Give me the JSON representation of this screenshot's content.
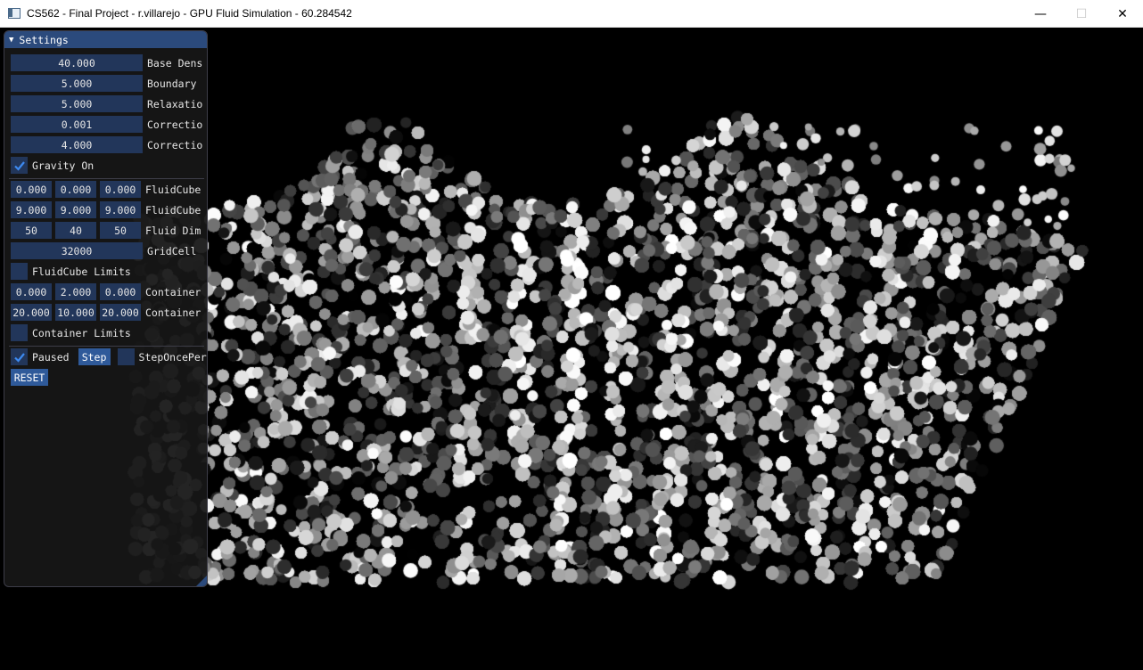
{
  "window": {
    "title": "CS562 - Final Project - r.villarejo - GPU Fluid Simulation - 60.284542",
    "minimize_glyph": "—",
    "maximize_glyph": "☐",
    "close_glyph": "✕"
  },
  "panel": {
    "header": "Settings",
    "collapse_glyph": "▼",
    "base_density": {
      "value": "40.000",
      "label": "Base Dens"
    },
    "boundary": {
      "value": "5.000",
      "label": "Boundary"
    },
    "relaxation": {
      "value": "5.000",
      "label": "Relaxatio"
    },
    "correction_1": {
      "value": "0.001",
      "label": "Correctio"
    },
    "correction_2": {
      "value": "4.000",
      "label": "Correctio"
    },
    "gravity": {
      "label": "Gravity On",
      "checked": true
    },
    "fluidcube_min": {
      "values": [
        "0.000",
        "0.000",
        "0.000"
      ],
      "label": "FluidCube"
    },
    "fluidcube_max": {
      "values": [
        "9.000",
        "9.000",
        "9.000"
      ],
      "label": "FluidCube"
    },
    "fluid_dim": {
      "values": [
        "50",
        "40",
        "50"
      ],
      "label": "Fluid Dim"
    },
    "grid_cell": {
      "value": "32000",
      "label": "GridCell"
    },
    "fluidcube_limits": {
      "label": "FluidCube Limits",
      "checked": false
    },
    "container_min": {
      "values": [
        "0.000",
        "2.000",
        "0.000"
      ],
      "label": "Container"
    },
    "container_max": {
      "values": [
        "20.000",
        "10.000",
        "20.000"
      ],
      "label": "Container"
    },
    "container_limits": {
      "label": "Container Limits",
      "checked": false
    },
    "paused": {
      "label": "Paused",
      "checked": true
    },
    "step_button": "Step",
    "step_once": {
      "label": "StepOncePer",
      "checked": false
    },
    "reset_button": "RESET"
  },
  "colors": {
    "panel_header": "#2b4a7c",
    "field_bg": "#22365a",
    "button_bg": "#2f5a9a",
    "check_mark": "#3d8af0"
  },
  "icons": [
    "app-icon",
    "minimize-icon",
    "maximize-icon",
    "close-icon",
    "collapse-arrow-icon",
    "checkmark-icon"
  ]
}
